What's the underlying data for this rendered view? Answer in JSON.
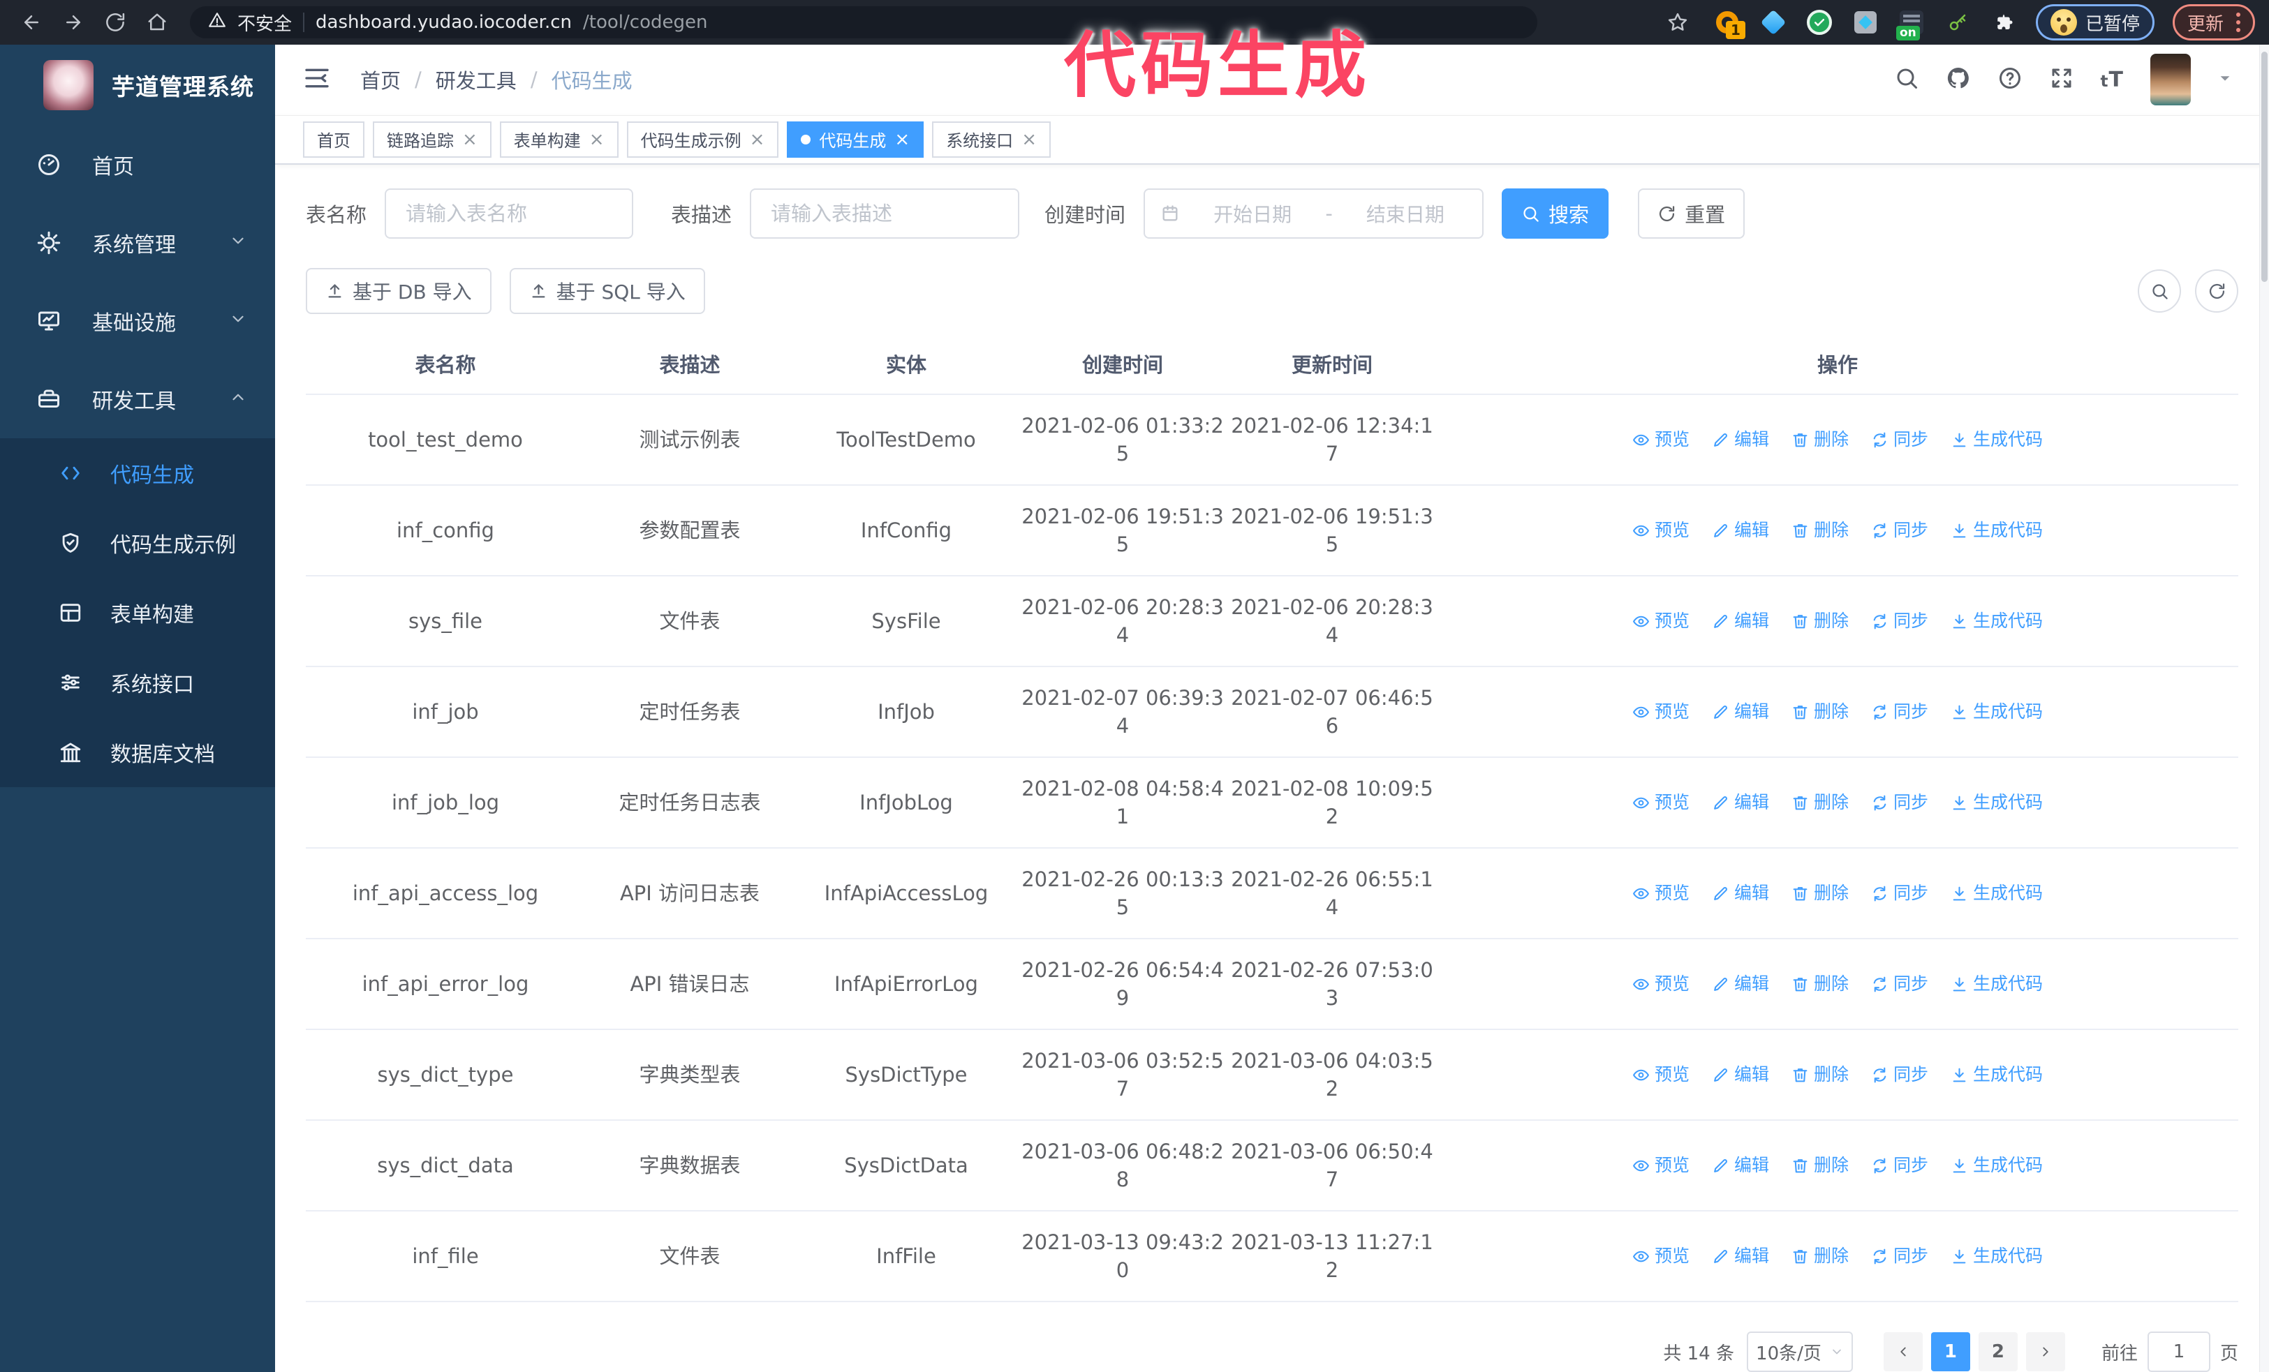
{
  "chrome": {
    "security_label": "不安全",
    "url_host": "dashboard.yudao.iocoder.cn",
    "url_path": "/tool/codegen",
    "extension_badge_count": "1",
    "extension_on_badge": "on",
    "profile_paused_label": "已暂停",
    "update_label": "更新"
  },
  "overlay_label": "代码生成",
  "sidebar": {
    "logo_title": "芋道管理系统",
    "items": [
      {
        "label": "首页"
      },
      {
        "label": "系统管理"
      },
      {
        "label": "基础设施"
      },
      {
        "label": "研发工具"
      }
    ],
    "subitems": [
      {
        "label": "代码生成"
      },
      {
        "label": "代码生成示例"
      },
      {
        "label": "表单构建"
      },
      {
        "label": "系统接口"
      },
      {
        "label": "数据库文档"
      }
    ]
  },
  "navbar": {
    "breadcrumb": [
      "首页",
      "研发工具",
      "代码生成"
    ],
    "separator": "/"
  },
  "tabs": [
    {
      "label": "首页"
    },
    {
      "label": "链路追踪"
    },
    {
      "label": "表单构建"
    },
    {
      "label": "代码生成示例"
    },
    {
      "label": "代码生成"
    },
    {
      "label": "系统接口"
    }
  ],
  "filters": {
    "name_label": "表名称",
    "name_placeholder": "请输入表名称",
    "desc_label": "表描述",
    "desc_placeholder": "请输入表描述",
    "time_label": "创建时间",
    "start_placeholder": "开始日期",
    "range_separator": "-",
    "end_placeholder": "结束日期",
    "search_label": "搜索",
    "reset_label": "重置"
  },
  "toolbar": {
    "import_db_label": "基于 DB 导入",
    "import_sql_label": "基于 SQL 导入"
  },
  "table": {
    "columns": [
      "表名称",
      "表描述",
      "实体",
      "创建时间",
      "更新时间",
      "操作"
    ],
    "actions": [
      "预览",
      "编辑",
      "删除",
      "同步",
      "生成代码"
    ],
    "rows": [
      {
        "name": "tool_test_demo",
        "desc": "测试示例表",
        "entity": "ToolTestDemo",
        "created": "2021-02-06 01:33:25",
        "updated": "2021-02-06 12:34:17"
      },
      {
        "name": "inf_config",
        "desc": "参数配置表",
        "entity": "InfConfig",
        "created": "2021-02-06 19:51:35",
        "updated": "2021-02-06 19:51:35"
      },
      {
        "name": "sys_file",
        "desc": "文件表",
        "entity": "SysFile",
        "created": "2021-02-06 20:28:34",
        "updated": "2021-02-06 20:28:34"
      },
      {
        "name": "inf_job",
        "desc": "定时任务表",
        "entity": "InfJob",
        "created": "2021-02-07 06:39:34",
        "updated": "2021-02-07 06:46:56"
      },
      {
        "name": "inf_job_log",
        "desc": "定时任务日志表",
        "entity": "InfJobLog",
        "created": "2021-02-08 04:58:41",
        "updated": "2021-02-08 10:09:52"
      },
      {
        "name": "inf_api_access_log",
        "desc": "API 访问日志表",
        "entity": "InfApiAccessLog",
        "created": "2021-02-26 00:13:35",
        "updated": "2021-02-26 06:55:14"
      },
      {
        "name": "inf_api_error_log",
        "desc": "API 错误日志",
        "entity": "InfApiErrorLog",
        "created": "2021-02-26 06:54:49",
        "updated": "2021-02-26 07:53:03"
      },
      {
        "name": "sys_dict_type",
        "desc": "字典类型表",
        "entity": "SysDictType",
        "created": "2021-03-06 03:52:57",
        "updated": "2021-03-06 04:03:52"
      },
      {
        "name": "sys_dict_data",
        "desc": "字典数据表",
        "entity": "SysDictData",
        "created": "2021-03-06 06:48:28",
        "updated": "2021-03-06 06:50:47"
      },
      {
        "name": "inf_file",
        "desc": "文件表",
        "entity": "InfFile",
        "created": "2021-03-13 09:43:20",
        "updated": "2021-03-13 11:27:12"
      }
    ]
  },
  "pagination": {
    "total_label": "共 14 条",
    "page_size_label": "10条/页",
    "pages": [
      "1",
      "2"
    ],
    "active_page": "1",
    "goto_label": "前往",
    "goto_value": "1",
    "goto_unit": "页"
  },
  "colors": {
    "primary": "#409EFF",
    "sidebar_bg": "#1f415e",
    "sidebar_submenu_bg": "#18344f",
    "chrome_bg": "#20252e",
    "overlay_text": "#fb4463"
  }
}
